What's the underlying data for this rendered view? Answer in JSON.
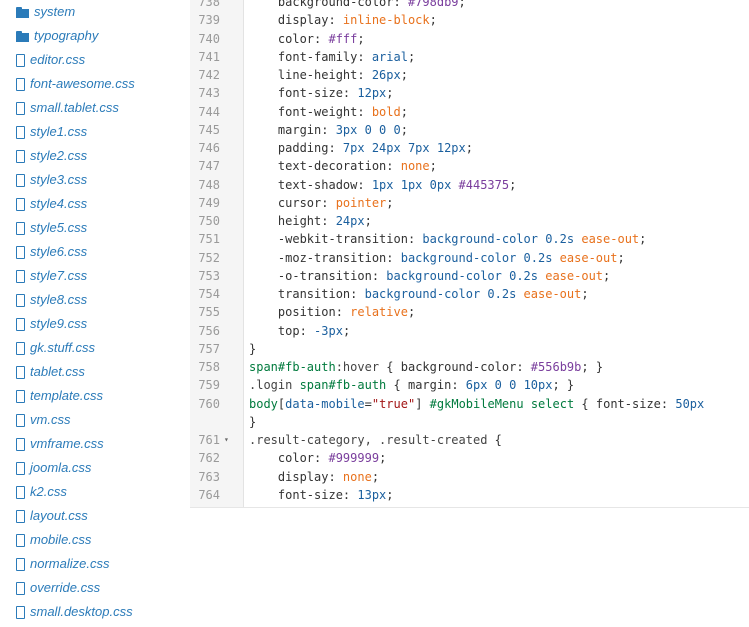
{
  "file_tree": {
    "items": [
      {
        "type": "folder",
        "label": "system",
        "icon": "folder-icon"
      },
      {
        "type": "folder",
        "label": "typography",
        "icon": "folder-icon"
      },
      {
        "type": "file",
        "label": "editor.css",
        "icon": "file-icon"
      },
      {
        "type": "file",
        "label": "font-awesome.css",
        "icon": "file-icon"
      },
      {
        "type": "file",
        "label": "small.tablet.css",
        "icon": "file-icon"
      },
      {
        "type": "file",
        "label": "style1.css",
        "icon": "file-icon"
      },
      {
        "type": "file",
        "label": "style2.css",
        "icon": "file-icon"
      },
      {
        "type": "file",
        "label": "style3.css",
        "icon": "file-icon"
      },
      {
        "type": "file",
        "label": "style4.css",
        "icon": "file-icon"
      },
      {
        "type": "file",
        "label": "style5.css",
        "icon": "file-icon"
      },
      {
        "type": "file",
        "label": "style6.css",
        "icon": "file-icon"
      },
      {
        "type": "file",
        "label": "style7.css",
        "icon": "file-icon"
      },
      {
        "type": "file",
        "label": "style8.css",
        "icon": "file-icon"
      },
      {
        "type": "file",
        "label": "style9.css",
        "icon": "file-icon"
      },
      {
        "type": "file",
        "label": "gk.stuff.css",
        "icon": "file-icon"
      },
      {
        "type": "file",
        "label": "tablet.css",
        "icon": "file-icon"
      },
      {
        "type": "file",
        "label": "template.css",
        "icon": "file-icon"
      },
      {
        "type": "file",
        "label": "vm.css",
        "icon": "file-icon"
      },
      {
        "type": "file",
        "label": "vmframe.css",
        "icon": "file-icon"
      },
      {
        "type": "file",
        "label": "joomla.css",
        "icon": "file-icon"
      },
      {
        "type": "file",
        "label": "k2.css",
        "icon": "file-icon"
      },
      {
        "type": "file",
        "label": "layout.css",
        "icon": "file-icon"
      },
      {
        "type": "file",
        "label": "mobile.css",
        "icon": "file-icon"
      },
      {
        "type": "file",
        "label": "normalize.css",
        "icon": "file-icon"
      },
      {
        "type": "file",
        "label": "override.css",
        "icon": "file-icon"
      },
      {
        "type": "file",
        "label": "small.desktop.css",
        "icon": "file-icon"
      }
    ]
  },
  "editor": {
    "lines": [
      {
        "n": "738",
        "tokens": [
          [
            "prop",
            "    background-color: "
          ],
          [
            "hex",
            "#798db9"
          ],
          [
            "punct",
            ";"
          ]
        ]
      },
      {
        "n": "739",
        "tokens": [
          [
            "prop",
            "    display: "
          ],
          [
            "keyword",
            "inline-block"
          ],
          [
            "punct",
            ";"
          ]
        ]
      },
      {
        "n": "740",
        "tokens": [
          [
            "prop",
            "    color: "
          ],
          [
            "hex",
            "#fff"
          ],
          [
            "punct",
            ";"
          ]
        ]
      },
      {
        "n": "741",
        "tokens": [
          [
            "prop",
            "    font-family: "
          ],
          [
            "value",
            "arial"
          ],
          [
            "punct",
            ";"
          ]
        ]
      },
      {
        "n": "742",
        "tokens": [
          [
            "prop",
            "    line-height: "
          ],
          [
            "value",
            "26px"
          ],
          [
            "punct",
            ";"
          ]
        ]
      },
      {
        "n": "743",
        "tokens": [
          [
            "prop",
            "    font-size: "
          ],
          [
            "value",
            "12px"
          ],
          [
            "punct",
            ";"
          ]
        ]
      },
      {
        "n": "744",
        "tokens": [
          [
            "prop",
            "    font-weight: "
          ],
          [
            "keyword",
            "bold"
          ],
          [
            "punct",
            ";"
          ]
        ]
      },
      {
        "n": "745",
        "tokens": [
          [
            "prop",
            "    margin: "
          ],
          [
            "value",
            "3px 0 0 0"
          ],
          [
            "punct",
            ";"
          ]
        ]
      },
      {
        "n": "746",
        "tokens": [
          [
            "prop",
            "    padding: "
          ],
          [
            "value",
            "7px 24px 7px 12px"
          ],
          [
            "punct",
            ";"
          ]
        ]
      },
      {
        "n": "747",
        "tokens": [
          [
            "prop",
            "    text-decoration: "
          ],
          [
            "keyword",
            "none"
          ],
          [
            "punct",
            ";"
          ]
        ]
      },
      {
        "n": "748",
        "tokens": [
          [
            "prop",
            "    text-shadow: "
          ],
          [
            "value",
            "1px 1px 0px "
          ],
          [
            "hex",
            "#445375"
          ],
          [
            "punct",
            ";"
          ]
        ]
      },
      {
        "n": "749",
        "tokens": [
          [
            "prop",
            "    cursor: "
          ],
          [
            "keyword",
            "pointer"
          ],
          [
            "punct",
            ";"
          ]
        ]
      },
      {
        "n": "750",
        "tokens": [
          [
            "prop",
            "    height: "
          ],
          [
            "value",
            "24px"
          ],
          [
            "punct",
            ";"
          ]
        ]
      },
      {
        "n": "751",
        "tokens": [
          [
            "prop",
            "    -webkit-transition: "
          ],
          [
            "value",
            "background-color 0.2s "
          ],
          [
            "keyword",
            "ease-out"
          ],
          [
            "punct",
            ";"
          ]
        ]
      },
      {
        "n": "752",
        "tokens": [
          [
            "prop",
            "    -moz-transition: "
          ],
          [
            "value",
            "background-color 0.2s "
          ],
          [
            "keyword",
            "ease-out"
          ],
          [
            "punct",
            ";"
          ]
        ]
      },
      {
        "n": "753",
        "tokens": [
          [
            "prop",
            "    -o-transition: "
          ],
          [
            "value",
            "background-color 0.2s "
          ],
          [
            "keyword",
            "ease-out"
          ],
          [
            "punct",
            ";"
          ]
        ]
      },
      {
        "n": "754",
        "tokens": [
          [
            "prop",
            "    transition: "
          ],
          [
            "value",
            "background-color 0.2s "
          ],
          [
            "keyword",
            "ease-out"
          ],
          [
            "punct",
            ";"
          ]
        ]
      },
      {
        "n": "755",
        "tokens": [
          [
            "prop",
            "    position: "
          ],
          [
            "keyword",
            "relative"
          ],
          [
            "punct",
            ";"
          ]
        ]
      },
      {
        "n": "756",
        "tokens": [
          [
            "prop",
            "    top: "
          ],
          [
            "value",
            "-3px"
          ],
          [
            "punct",
            ";"
          ]
        ]
      },
      {
        "n": "757",
        "tokens": [
          [
            "punct",
            "}"
          ]
        ]
      },
      {
        "n": "758",
        "tokens": [
          [
            "tag",
            "span"
          ],
          [
            "tag",
            "#fb-auth"
          ],
          [
            "class",
            ":hover"
          ],
          [
            "punct",
            " { "
          ],
          [
            "prop",
            "background-color: "
          ],
          [
            "hex",
            "#556b9b"
          ],
          [
            "punct",
            "; }"
          ]
        ]
      },
      {
        "n": "759",
        "tokens": [
          [
            "class",
            ".login "
          ],
          [
            "tag",
            "span"
          ],
          [
            "tag",
            "#fb-auth"
          ],
          [
            "punct",
            " { "
          ],
          [
            "prop",
            "margin: "
          ],
          [
            "value",
            "6px 0 0 10px"
          ],
          [
            "punct",
            "; }"
          ]
        ]
      },
      {
        "n": "760",
        "tokens": [
          [
            "tag",
            "body"
          ],
          [
            "punct",
            "["
          ],
          [
            "attr",
            "data-mobile"
          ],
          [
            "punct",
            "="
          ],
          [
            "string",
            "\"true\""
          ],
          [
            "punct",
            "] "
          ],
          [
            "tag",
            "#gkMobileMenu"
          ],
          [
            "punct",
            " "
          ],
          [
            "tag",
            "select"
          ],
          [
            "punct",
            " { "
          ],
          [
            "prop",
            "font-size: "
          ],
          [
            "value",
            "50px"
          ]
        ]
      },
      {
        "n": "",
        "tokens": [
          [
            "punct",
            "}"
          ]
        ]
      },
      {
        "n": "761",
        "fold": "▾",
        "tokens": [
          [
            "class",
            ".result-category, .result-created"
          ],
          [
            "punct",
            " {"
          ]
        ]
      },
      {
        "n": "762",
        "tokens": [
          [
            "prop",
            "    color: "
          ],
          [
            "hex",
            "#999999"
          ],
          [
            "punct",
            ";"
          ]
        ]
      },
      {
        "n": "763",
        "tokens": [
          [
            "prop",
            "    display: "
          ],
          [
            "keyword",
            "none"
          ],
          [
            "punct",
            ";"
          ]
        ]
      },
      {
        "n": "764",
        "tokens": [
          [
            "prop",
            "    font-size: "
          ],
          [
            "value",
            "13px"
          ],
          [
            "punct",
            ";"
          ]
        ]
      }
    ]
  }
}
